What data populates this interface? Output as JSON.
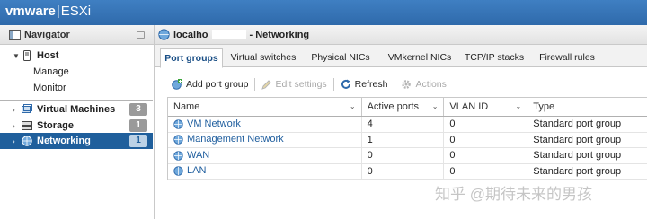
{
  "header": {
    "brand_vm": "vm",
    "brand_ware": "ware",
    "brand_product": "ESXi",
    "brand_sep": "|"
  },
  "navigator": {
    "title": "Navigator",
    "host": {
      "label": "Host",
      "children": [
        "Manage",
        "Monitor"
      ]
    },
    "items": [
      {
        "label": "Virtual Machines",
        "count": "3"
      },
      {
        "label": "Storage",
        "count": "1"
      },
      {
        "label": "Networking",
        "count": "1"
      }
    ]
  },
  "main": {
    "breadcrumb": {
      "host": "localho",
      "suffix": "- Networking"
    },
    "tabs": [
      "Port groups",
      "Virtual switches",
      "Physical NICs",
      "VMkernel NICs",
      "TCP/IP stacks",
      "Firewall rules"
    ],
    "toolbar": {
      "add": "Add port group",
      "edit": "Edit settings",
      "refresh": "Refresh",
      "actions": "Actions"
    },
    "table": {
      "columns": [
        "Name",
        "Active ports",
        "VLAN ID",
        "Type"
      ],
      "rows": [
        [
          "VM Network",
          "4",
          "0",
          "Standard port group"
        ],
        [
          "Management Network",
          "1",
          "0",
          "Standard port group"
        ],
        [
          "WAN",
          "0",
          "0",
          "Standard port group"
        ],
        [
          "LAN",
          "0",
          "0",
          "Standard port group"
        ]
      ]
    }
  },
  "watermark": "知乎 @期待未来的男孩",
  "colors": {
    "header_blue": "#2f6aab",
    "nav_active": "#1f5f9c",
    "link_blue": "#1f5e9e"
  }
}
